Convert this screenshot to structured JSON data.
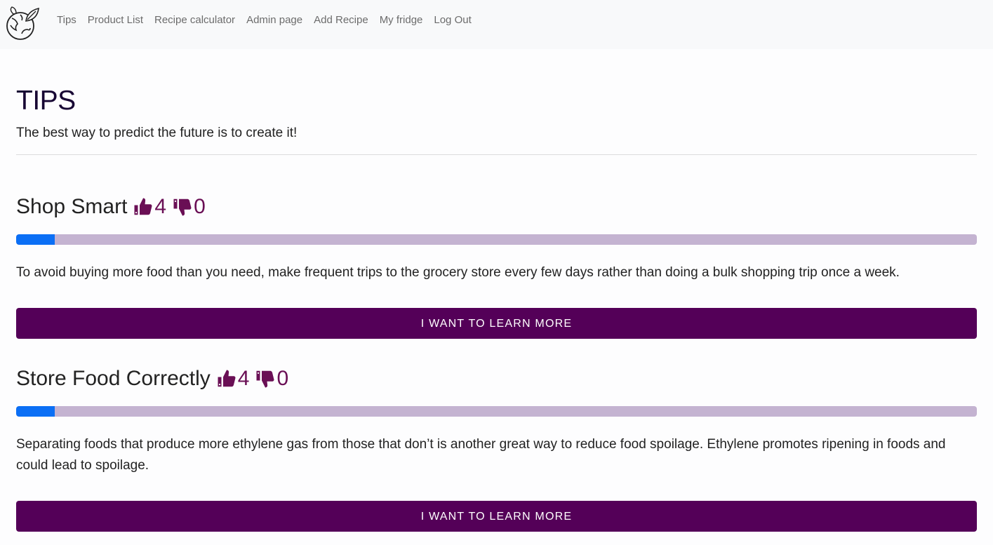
{
  "nav": {
    "logo_icon": "globe-leaf-logo",
    "links": [
      "Tips",
      "Product List",
      "Recipe calculator",
      "Admin page",
      "Add Recipe",
      "My fridge",
      "Log Out"
    ]
  },
  "page": {
    "title": "TIPS",
    "subtitle": "The best way to predict the future is to create it!"
  },
  "tips": [
    {
      "title": "Shop Smart",
      "likes": "4",
      "dislikes": "0",
      "progress": 0.04,
      "text": "To avoid buying more food than you need, make frequent trips to the grocery store every few days rather than doing a bulk shopping trip once a week.",
      "button": "I WANT TO LEARN MORE"
    },
    {
      "title": "Store Food Correctly",
      "likes": "4",
      "dislikes": "0",
      "progress": 0.04,
      "text": "Separating foods that produce more ethylene gas from those that don’t is another great way to reduce food spoilage. Ethylene promotes ripening in foods and could lead to spoilage.",
      "button": "I WANT TO LEARN MORE"
    }
  ],
  "colors": {
    "nav_bg": "#f8f9fa",
    "accent": "#540058",
    "vote": "#6a0f55",
    "progress_fill": "#0b6ff5",
    "progress_track": "#c4b3d1"
  }
}
